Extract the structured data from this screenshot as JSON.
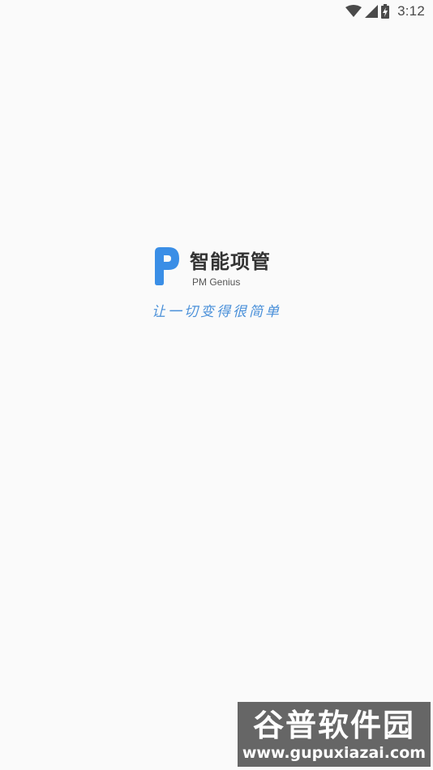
{
  "status_bar": {
    "time": "3:12",
    "icons": [
      "wifi-icon",
      "signal-icon",
      "battery-charging-icon"
    ]
  },
  "splash": {
    "brand_name": "智能项管",
    "brand_subtitle": "PM Genius",
    "slogan": "让一切变得很简单",
    "logo": "p-logo-icon"
  },
  "watermark": {
    "title": "谷普软件园",
    "url": "www.gupuxiazai.com"
  },
  "colors": {
    "background": "#fafafa",
    "logo_blue": "#3a8ee6",
    "slogan_blue": "#4a90d9",
    "text_dark": "#333333"
  }
}
